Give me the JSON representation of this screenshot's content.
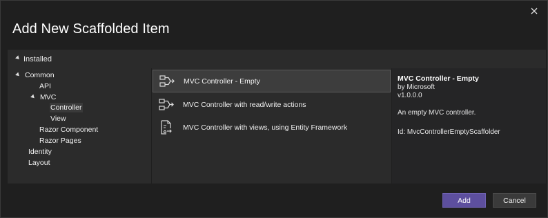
{
  "dialog": {
    "title": "Add New Scaffolded Item",
    "close_icon": "close-icon"
  },
  "installed": {
    "label": "Installed"
  },
  "tree": {
    "items": [
      {
        "label": "Common",
        "expanded": true
      },
      {
        "label": "API"
      },
      {
        "label": "MVC",
        "expanded": true
      },
      {
        "label": "Controller",
        "selected": true
      },
      {
        "label": "View"
      },
      {
        "label": "Razor Component"
      },
      {
        "label": "Razor Pages"
      },
      {
        "label": "Identity"
      },
      {
        "label": "Layout"
      }
    ]
  },
  "templates": {
    "items": [
      {
        "label": "MVC Controller - Empty",
        "icon": "controller-icon",
        "selected": true
      },
      {
        "label": "MVC Controller with read/write actions",
        "icon": "controller-icon"
      },
      {
        "label": "MVC Controller with views, using Entity Framework",
        "icon": "controller-views-icon"
      }
    ]
  },
  "details": {
    "title": "MVC Controller - Empty",
    "author": "by Microsoft",
    "version": "v1.0.0.0",
    "description": "An empty MVC controller.",
    "id": "Id: MvcControllerEmptyScaffolder"
  },
  "buttons": {
    "add": "Add",
    "cancel": "Cancel"
  },
  "colors": {
    "background": "#1f1f1f",
    "panel": "#2b2b2b",
    "accent": "#5d4f9e"
  }
}
